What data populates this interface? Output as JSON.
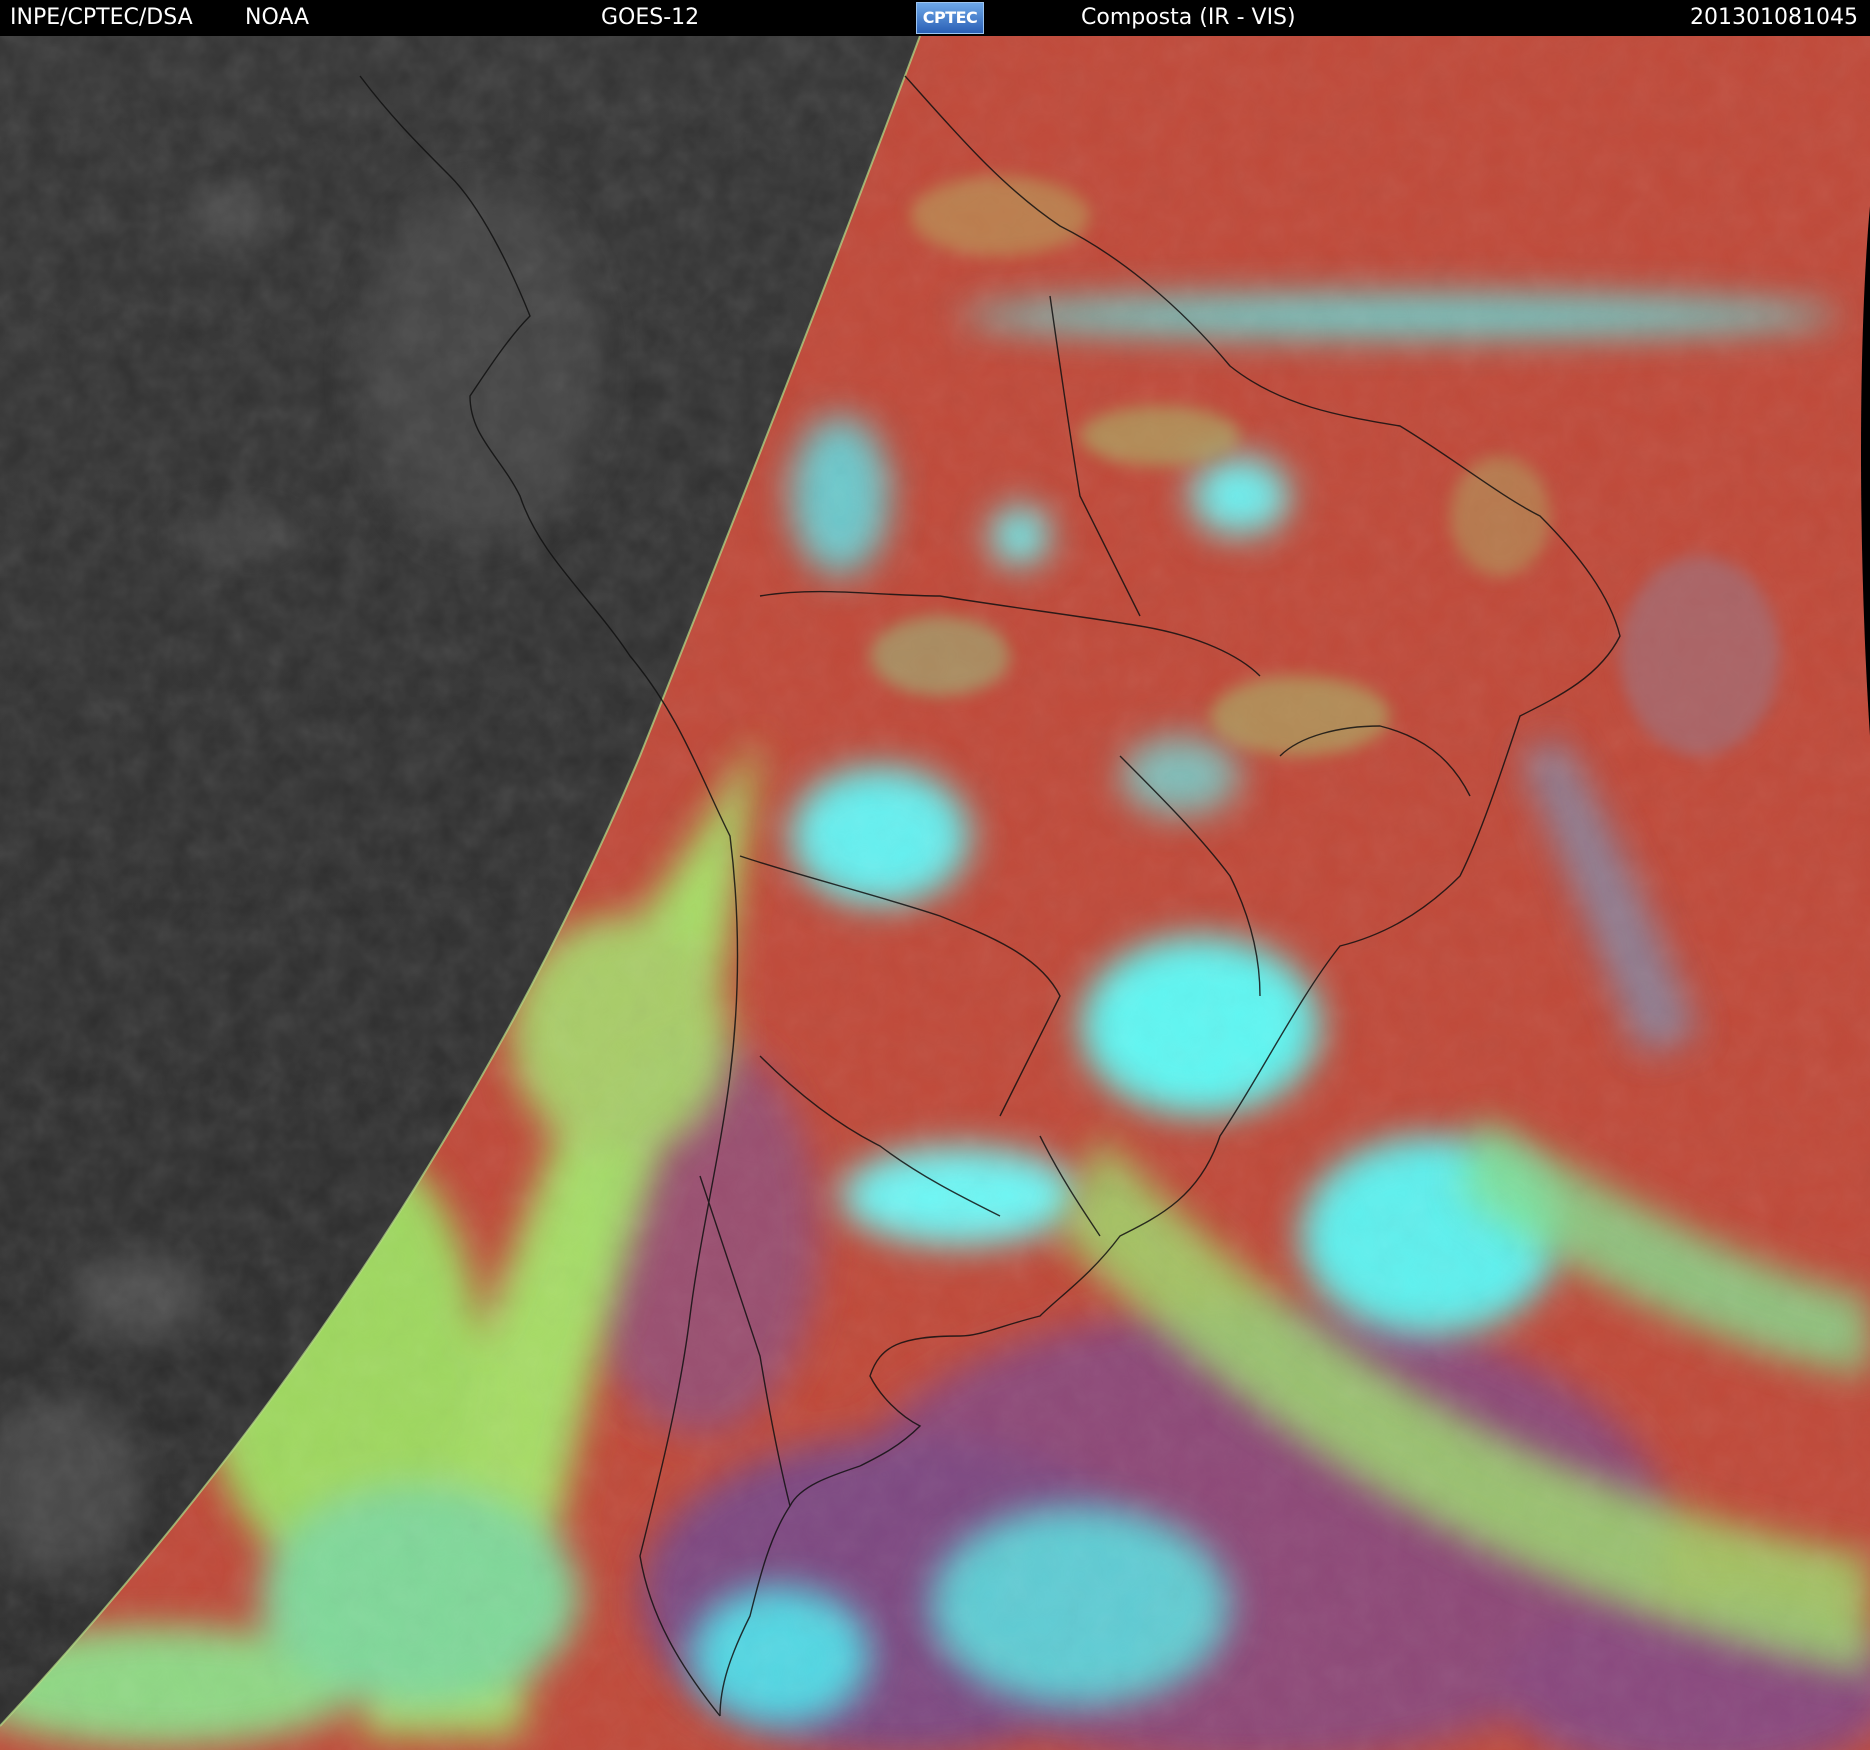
{
  "header": {
    "source": "INPE/CPTEC/DSA",
    "agency": "NOAA",
    "satellite": "GOES-12",
    "logo_text": "CPTEC",
    "product": "Composta (IR - VIS)",
    "timestamp": "201301081045"
  },
  "colors": {
    "night_side": "#2e2e2e",
    "clear_ocean_land": "#c04a3a",
    "low_cloud": "#9ee064",
    "high_cloud": "#58f0f0",
    "mid_cloud": "#8a6a9a",
    "borders": "#111111"
  }
}
